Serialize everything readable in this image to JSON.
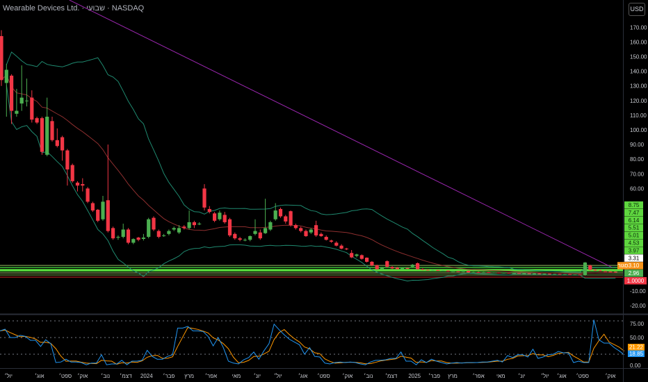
{
  "header": {
    "title": "Wearable Devices Ltd. · שבועי · NASDAQ",
    "currency_button": "USD"
  },
  "colors": {
    "up": "#4caf50",
    "down": "#f23645",
    "band": "#1f8a70",
    "basis": "#8e2f2f",
    "trend": "#9c27b0",
    "k_line": "#2196f3",
    "d_line": "#ff9800"
  },
  "price_axis": {
    "ticks": [
      "170.00",
      "160.00",
      "150.00",
      "140.00",
      "130.00",
      "120.00",
      "110.00",
      "100.00",
      "90.00",
      "80.00",
      "70.00",
      "60.00",
      "-10.00",
      "-20.00"
    ],
    "tick_values": [
      170,
      160,
      150,
      140,
      130,
      120,
      110,
      100,
      90,
      80,
      70,
      60,
      -10,
      -20
    ],
    "labels": [
      {
        "text": "8.75",
        "bg": "#5fd63f",
        "fg": "#0b2a0b"
      },
      {
        "text": "7.47",
        "bg": "#5fd63f",
        "fg": "#0b2a0b"
      },
      {
        "text": "6.14",
        "bg": "#5fd63f",
        "fg": "#0b2a0b"
      },
      {
        "text": "5.51",
        "bg": "#5fd63f",
        "fg": "#0b2a0b"
      },
      {
        "text": "5.01",
        "bg": "#5fd63f",
        "fg": "#0b2a0b"
      },
      {
        "text": "4.53",
        "bg": "#5fd63f",
        "fg": "#0b2a0b"
      },
      {
        "text": "3.97",
        "bg": "#5fd63f",
        "fg": "#0b2a0b"
      },
      {
        "text": "3.31",
        "bg": "#ffffff",
        "fg": "#000000"
      },
      {
        "text": "3.10",
        "bg": "#f7931a",
        "fg": "#ffffff"
      },
      {
        "text": "2.96",
        "bg": "#4caf50",
        "fg": "#ffffff"
      },
      {
        "text": "1.0000",
        "bg": "#f23645",
        "fg": "#ffffff"
      }
    ],
    "close_tag": "סגור"
  },
  "oscillator_axis": {
    "ticks": [
      "75.00",
      "50.00",
      "0.00"
    ],
    "tick_values": [
      75,
      50,
      0
    ],
    "levels": [
      80,
      50,
      20
    ],
    "k_label": "18.85",
    "d_label": "21.22"
  },
  "time_axis": [
    "יול׳",
    "אוג׳",
    "ספט׳",
    "אוק׳",
    "נוב׳",
    "דצמ׳",
    "2024",
    "פבר׳",
    "מרץ",
    "אפר׳",
    "מאי",
    "יונ׳",
    "יול׳",
    "אוג׳",
    "ספט׳",
    "אוק׳",
    "נוב׳",
    "דצמ׳",
    "2025",
    "פבר׳",
    "מרץ",
    "אפר׳",
    "מאי",
    "יונ׳",
    "יול׳",
    "אוג׳",
    "ספט׳",
    "אוק׳"
  ],
  "time_axis_index": [
    1.4,
    7.5,
    12.6,
    16,
    20.5,
    24.5,
    28.6,
    33,
    37,
    41.3,
    46.3,
    50.4,
    54.5,
    59.4,
    63.5,
    68.2,
    72.3,
    76.8,
    81.4,
    85.3,
    88.9,
    94,
    98.4,
    102.5,
    107.1,
    110.4,
    114.5,
    120
  ],
  "chart_data": {
    "type": "candlestick",
    "ohlc": [
      [
        164,
        168,
        130,
        134
      ],
      [
        132,
        145,
        109,
        141
      ],
      [
        137,
        138,
        104,
        113
      ],
      [
        111,
        128,
        109,
        113
      ],
      [
        118,
        144,
        113,
        122
      ],
      [
        120,
        135,
        116,
        120
      ],
      [
        122,
        127,
        105,
        107
      ],
      [
        108,
        109,
        104,
        105
      ],
      [
        108,
        109,
        83,
        85
      ],
      [
        83,
        122,
        82,
        109
      ],
      [
        106,
        109,
        92,
        93
      ],
      [
        93,
        101,
        88,
        89
      ],
      [
        95,
        96,
        79,
        86
      ],
      [
        86,
        87,
        62,
        73
      ],
      [
        76,
        77,
        64,
        65
      ],
      [
        64,
        65,
        58,
        62
      ],
      [
        63,
        67,
        58,
        62
      ],
      [
        60,
        61,
        50,
        51
      ],
      [
        50,
        51,
        44,
        45
      ],
      [
        45.5,
        46,
        37,
        38
      ],
      [
        39,
        55,
        38,
        51
      ],
      [
        52,
        90,
        30,
        31
      ],
      [
        33,
        34,
        25,
        26
      ],
      [
        26.5,
        28,
        25,
        27
      ],
      [
        27,
        36,
        26,
        32
      ],
      [
        32,
        33,
        22,
        23
      ],
      [
        23,
        26,
        22,
        25.5
      ],
      [
        26.5,
        27,
        24,
        25
      ],
      [
        25.6,
        29,
        24.5,
        26.5
      ],
      [
        27,
        40,
        26,
        39
      ],
      [
        40,
        41,
        31,
        32
      ],
      [
        31,
        32,
        26,
        27
      ],
      [
        28,
        29,
        27,
        28
      ],
      [
        29,
        32,
        28,
        31
      ],
      [
        32,
        34,
        31,
        33
      ],
      [
        30,
        35,
        29,
        33
      ],
      [
        34,
        35,
        32,
        33
      ],
      [
        33,
        45,
        32,
        37
      ],
      [
        37,
        38,
        33,
        35
      ],
      [
        36,
        37,
        35,
        36
      ],
      [
        60,
        63,
        45,
        47
      ],
      [
        46,
        48,
        43,
        44
      ],
      [
        43,
        44,
        37,
        38
      ],
      [
        39,
        45,
        38,
        43.5
      ],
      [
        42,
        44,
        36,
        37
      ],
      [
        39,
        40,
        27,
        28
      ],
      [
        29,
        30,
        25,
        26
      ],
      [
        26,
        27,
        24,
        25
      ],
      [
        25,
        26,
        24,
        25
      ],
      [
        25,
        28,
        24,
        27.5
      ],
      [
        29,
        39,
        28,
        31
      ],
      [
        30,
        32,
        25,
        26
      ],
      [
        29.5,
        53,
        29,
        33
      ],
      [
        32,
        38,
        31,
        37
      ],
      [
        39,
        50,
        38,
        45
      ],
      [
        46,
        47,
        40,
        41
      ],
      [
        41,
        42,
        36,
        37.5
      ],
      [
        44.5,
        45,
        34,
        35
      ],
      [
        35,
        36,
        32,
        33
      ],
      [
        33,
        34,
        30,
        31
      ],
      [
        31,
        32,
        27,
        27.5
      ],
      [
        30,
        33,
        29,
        32
      ],
      [
        35,
        38,
        27,
        28
      ],
      [
        29,
        30,
        27,
        27.5
      ],
      [
        27,
        28,
        24.5,
        25
      ],
      [
        24.5,
        25,
        23,
        23.7
      ],
      [
        23,
        24,
        20.5,
        21
      ],
      [
        21,
        22,
        18.5,
        19
      ],
      [
        19,
        19.5,
        18,
        18.5
      ],
      [
        16,
        18,
        12.5,
        13
      ],
      [
        14,
        15.5,
        13,
        15
      ],
      [
        14.5,
        15,
        11.5,
        12
      ],
      [
        12.8,
        13,
        9.5,
        10
      ],
      [
        10,
        10.5,
        7,
        7.6
      ],
      [
        7.6,
        8,
        4.5,
        5
      ],
      [
        5,
        6.5,
        4.5,
        6
      ],
      [
        10.4,
        11,
        6,
        6.6
      ],
      [
        6.5,
        7,
        5,
        5.5
      ],
      [
        6,
        6.5,
        4.8,
        5
      ],
      [
        5,
        6,
        4.8,
        5.8
      ],
      [
        5.8,
        6,
        5,
        5.2
      ],
      [
        6.6,
        8.5,
        6,
        8
      ],
      [
        9,
        9.5,
        4.5,
        5
      ],
      [
        5,
        5.5,
        4.2,
        4.5
      ],
      [
        4.5,
        4.8,
        4,
        4.2
      ],
      [
        4.2,
        4.6,
        3.9,
        4.4
      ],
      [
        4.4,
        4.5,
        3.7,
        3.8
      ],
      [
        3.8,
        4.2,
        3.5,
        4
      ],
      [
        4,
        4.1,
        3.2,
        3.4
      ],
      [
        3.4,
        3.8,
        3.2,
        3.6
      ],
      [
        3.6,
        3.7,
        3,
        3.1
      ],
      [
        3.1,
        4,
        3,
        3.8
      ],
      [
        3.8,
        4,
        2.6,
        2.8
      ],
      [
        2.8,
        3.1,
        2.5,
        2.9
      ],
      [
        2.9,
        3.2,
        2.6,
        2.7
      ],
      [
        2.7,
        3,
        2.4,
        2.9
      ],
      [
        2.9,
        3,
        2.3,
        2.4
      ],
      [
        2.4,
        2.8,
        2.2,
        2.6
      ],
      [
        2.6,
        2.7,
        2.1,
        2.2
      ],
      [
        2.2,
        2.6,
        2,
        2.5
      ],
      [
        2.5,
        2.6,
        2,
        2.1
      ],
      [
        2.1,
        2.4,
        1.9,
        2.3
      ],
      [
        2.3,
        2.4,
        1.8,
        1.9
      ],
      [
        1.9,
        2.2,
        1.7,
        2.1
      ],
      [
        2.1,
        2.2,
        1.6,
        1.7
      ],
      [
        1.7,
        2.1,
        1.6,
        2
      ],
      [
        2,
        2.1,
        1.5,
        1.6
      ],
      [
        1.6,
        1.9,
        1.4,
        1.8
      ],
      [
        1.8,
        1.9,
        1.3,
        1.4
      ],
      [
        1.4,
        1.7,
        1.3,
        1.6
      ],
      [
        1.6,
        1.7,
        1.2,
        1.3
      ],
      [
        1.3,
        1.6,
        1.2,
        1.5
      ],
      [
        1.5,
        1.6,
        1.1,
        1.2
      ],
      [
        1.2,
        1.4,
        1.1,
        1.3
      ],
      [
        1.3,
        1.4,
        1,
        1.1
      ],
      [
        1,
        9.8,
        0.5,
        9.5
      ],
      [
        7.5,
        8,
        4,
        4.5
      ],
      [
        4.5,
        5,
        3.6,
        4
      ],
      [
        4,
        4.5,
        3.4,
        3.6
      ],
      [
        3.6,
        3.9,
        3.2,
        3.4
      ],
      [
        3.4,
        3.6,
        3,
        3.2
      ],
      [
        3.2,
        3.4,
        2.9,
        3.1
      ]
    ],
    "bollinger_period": 20,
    "bollinger_mult": 2,
    "trendline": [
      [
        13.4,
        188.6
      ],
      [
        120.3,
        6.2
      ]
    ],
    "levels": [
      {
        "price": 7.5,
        "color": "#6e8f47"
      },
      {
        "price": 6.1,
        "color": "#3fbf3a"
      },
      {
        "price": 4.6,
        "color": "#56d93c"
      },
      {
        "price": 3.9,
        "color": "#56d93c"
      },
      {
        "price": 2.4,
        "color": "#7d9b55"
      },
      {
        "price": 1.0,
        "color": "#5c7a35"
      },
      {
        "price": -0.5,
        "color": "#9b1d1d"
      }
    ],
    "oscillator_k": [
      62,
      65,
      50,
      50,
      54,
      52,
      45,
      45,
      34,
      46,
      39,
      5,
      6,
      11,
      6,
      6,
      5,
      1,
      4,
      4,
      19,
      1,
      2.5,
      2.5,
      9,
      1,
      7.5,
      7.5,
      9,
      27,
      16,
      11,
      11,
      16,
      19,
      67,
      67,
      70,
      62,
      62,
      61,
      52,
      35,
      50,
      32,
      7.5,
      4,
      2.5,
      10,
      14,
      24,
      11,
      26,
      39,
      74,
      64,
      55,
      47,
      42,
      37,
      20,
      32,
      16,
      15,
      4,
      2.5,
      5,
      6,
      5,
      6,
      5,
      2.5,
      1,
      6,
      9,
      9,
      10,
      12.5,
      12.5,
      24,
      7.5,
      7.5,
      1,
      10,
      5,
      11,
      7.5,
      5,
      2.5,
      4,
      5,
      4,
      5,
      5,
      5,
      6,
      6,
      7.5,
      9,
      6,
      17.5,
      14,
      19,
      19,
      15,
      29,
      12.5,
      15,
      19,
      20,
      25,
      22.5,
      22.5,
      5,
      7.5,
      5,
      5,
      82,
      46,
      40,
      40,
      32,
      26,
      18.85
    ],
    "oscillator_d_smoothing": 3,
    "price_range": [
      -25,
      188
    ],
    "oscillator_range": [
      0,
      85
    ]
  }
}
